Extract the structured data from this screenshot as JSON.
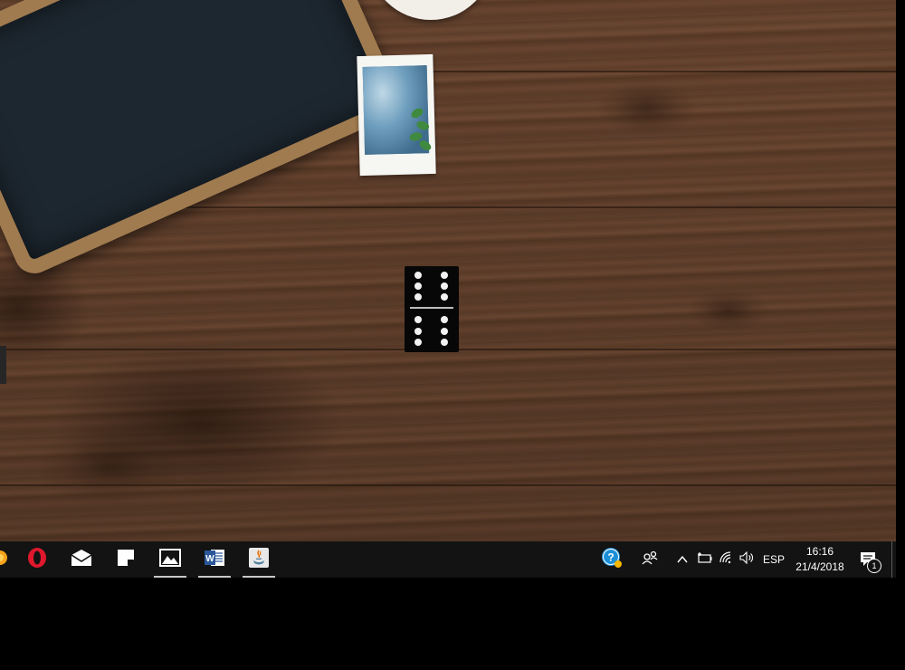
{
  "desktop": {
    "wallpaper": "wood-table-with-chalkboard-and-polaroid",
    "domino": {
      "top_pips": 6,
      "bottom_pips": 6
    }
  },
  "taskbar": {
    "apps": [
      {
        "name": "firefox-partial",
        "icon": "firefox-icon",
        "active": false
      },
      {
        "name": "opera",
        "icon": "opera-icon",
        "active": false
      },
      {
        "name": "mail",
        "icon": "mail-icon",
        "active": false
      },
      {
        "name": "sticky-notes",
        "icon": "sticky-notes-icon",
        "active": false
      },
      {
        "name": "photos",
        "icon": "photos-icon",
        "active": true
      },
      {
        "name": "word",
        "icon": "word-icon",
        "active": true
      },
      {
        "name": "java",
        "icon": "java-icon",
        "active": true
      }
    ],
    "tray": {
      "help_icon": "help-icon",
      "people_icon": "people-icon",
      "chevron_icon": "chevron-up-icon",
      "battery_icon": "battery-icon",
      "wifi_icon": "wifi-icon",
      "volume_icon": "volume-icon",
      "language": "ESP",
      "time": "16:16",
      "date": "21/4/2018",
      "notifications_count": "1"
    }
  },
  "colors": {
    "taskbar": "#131313",
    "opera_red": "#e0182d",
    "word_blue": "#2b579a",
    "help_blue": "#1c8fd6"
  }
}
